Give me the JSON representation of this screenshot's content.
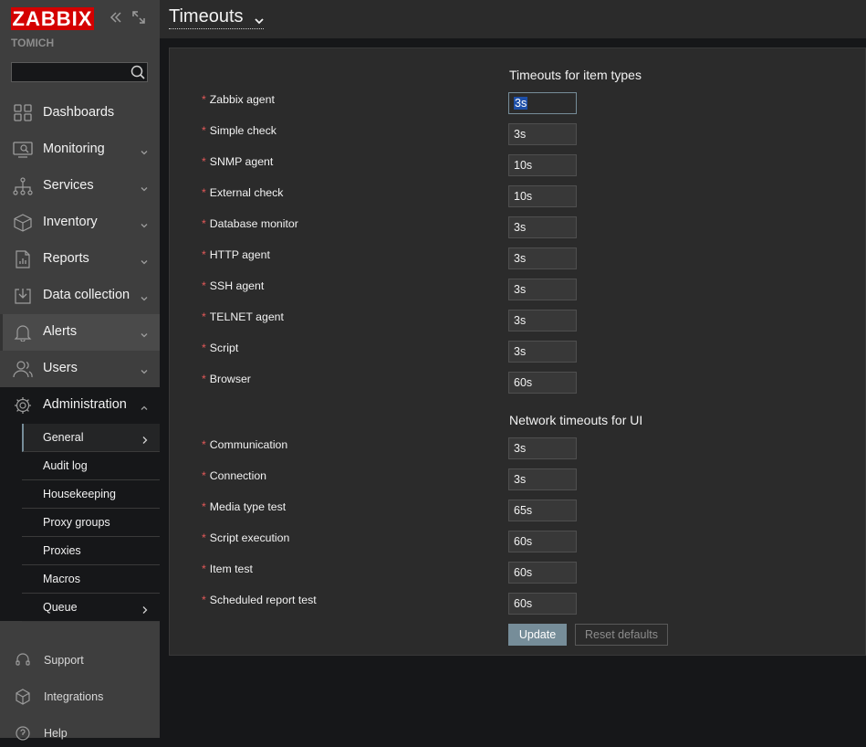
{
  "app": {
    "logo": "ZABBIX",
    "tenant": "TOMICH",
    "search_placeholder": ""
  },
  "nav": {
    "items": [
      {
        "label": "Dashboards",
        "icon": "dashboard-grid-icon",
        "has_chevron": false
      },
      {
        "label": "Monitoring",
        "icon": "monitoring-icon",
        "has_chevron": true
      },
      {
        "label": "Services",
        "icon": "services-hierarchy-icon",
        "has_chevron": true
      },
      {
        "label": "Inventory",
        "icon": "inventory-box-icon",
        "has_chevron": true
      },
      {
        "label": "Reports",
        "icon": "reports-document-icon",
        "has_chevron": true
      },
      {
        "label": "Data collection",
        "icon": "data-collection-icon",
        "has_chevron": true
      },
      {
        "label": "Alerts",
        "icon": "bell-icon",
        "has_chevron": true
      },
      {
        "label": "Users",
        "icon": "users-icon",
        "has_chevron": true
      },
      {
        "label": "Administration",
        "icon": "gear-icon",
        "has_chevron": true,
        "expanded": true
      }
    ],
    "admin_submenu": [
      {
        "label": "General",
        "active": true,
        "has_chevron": true
      },
      {
        "label": "Audit log"
      },
      {
        "label": "Housekeeping"
      },
      {
        "label": "Proxy groups"
      },
      {
        "label": "Proxies"
      },
      {
        "label": "Macros"
      },
      {
        "label": "Queue",
        "has_chevron": true
      }
    ],
    "footer": [
      {
        "label": "Support",
        "icon": "headset-icon"
      },
      {
        "label": "Integrations",
        "icon": "integrations-icon"
      },
      {
        "label": "Help",
        "icon": "help-icon"
      }
    ]
  },
  "header": {
    "title": "Timeouts"
  },
  "form": {
    "section_item_types": "Timeouts for item types",
    "item_types": [
      {
        "label": "Zabbix agent",
        "value": "3s"
      },
      {
        "label": "Simple check",
        "value": "3s"
      },
      {
        "label": "SNMP agent",
        "value": "10s"
      },
      {
        "label": "External check",
        "value": "10s"
      },
      {
        "label": "Database monitor",
        "value": "3s"
      },
      {
        "label": "HTTP agent",
        "value": "3s"
      },
      {
        "label": "SSH agent",
        "value": "3s"
      },
      {
        "label": "TELNET agent",
        "value": "3s"
      },
      {
        "label": "Script",
        "value": "3s"
      },
      {
        "label": "Browser",
        "value": "60s"
      }
    ],
    "section_network": "Network timeouts for UI",
    "network": [
      {
        "label": "Communication",
        "value": "3s"
      },
      {
        "label": "Connection",
        "value": "3s"
      },
      {
        "label": "Media type test",
        "value": "65s"
      },
      {
        "label": "Script execution",
        "value": "60s"
      },
      {
        "label": "Item test",
        "value": "60s"
      },
      {
        "label": "Scheduled report test",
        "value": "60s"
      }
    ],
    "required_mark": "*",
    "update_label": "Update",
    "reset_label": "Reset defaults"
  },
  "colors": {
    "brand_red": "#d40000",
    "accent": "#768d99",
    "required": "#e45959"
  }
}
